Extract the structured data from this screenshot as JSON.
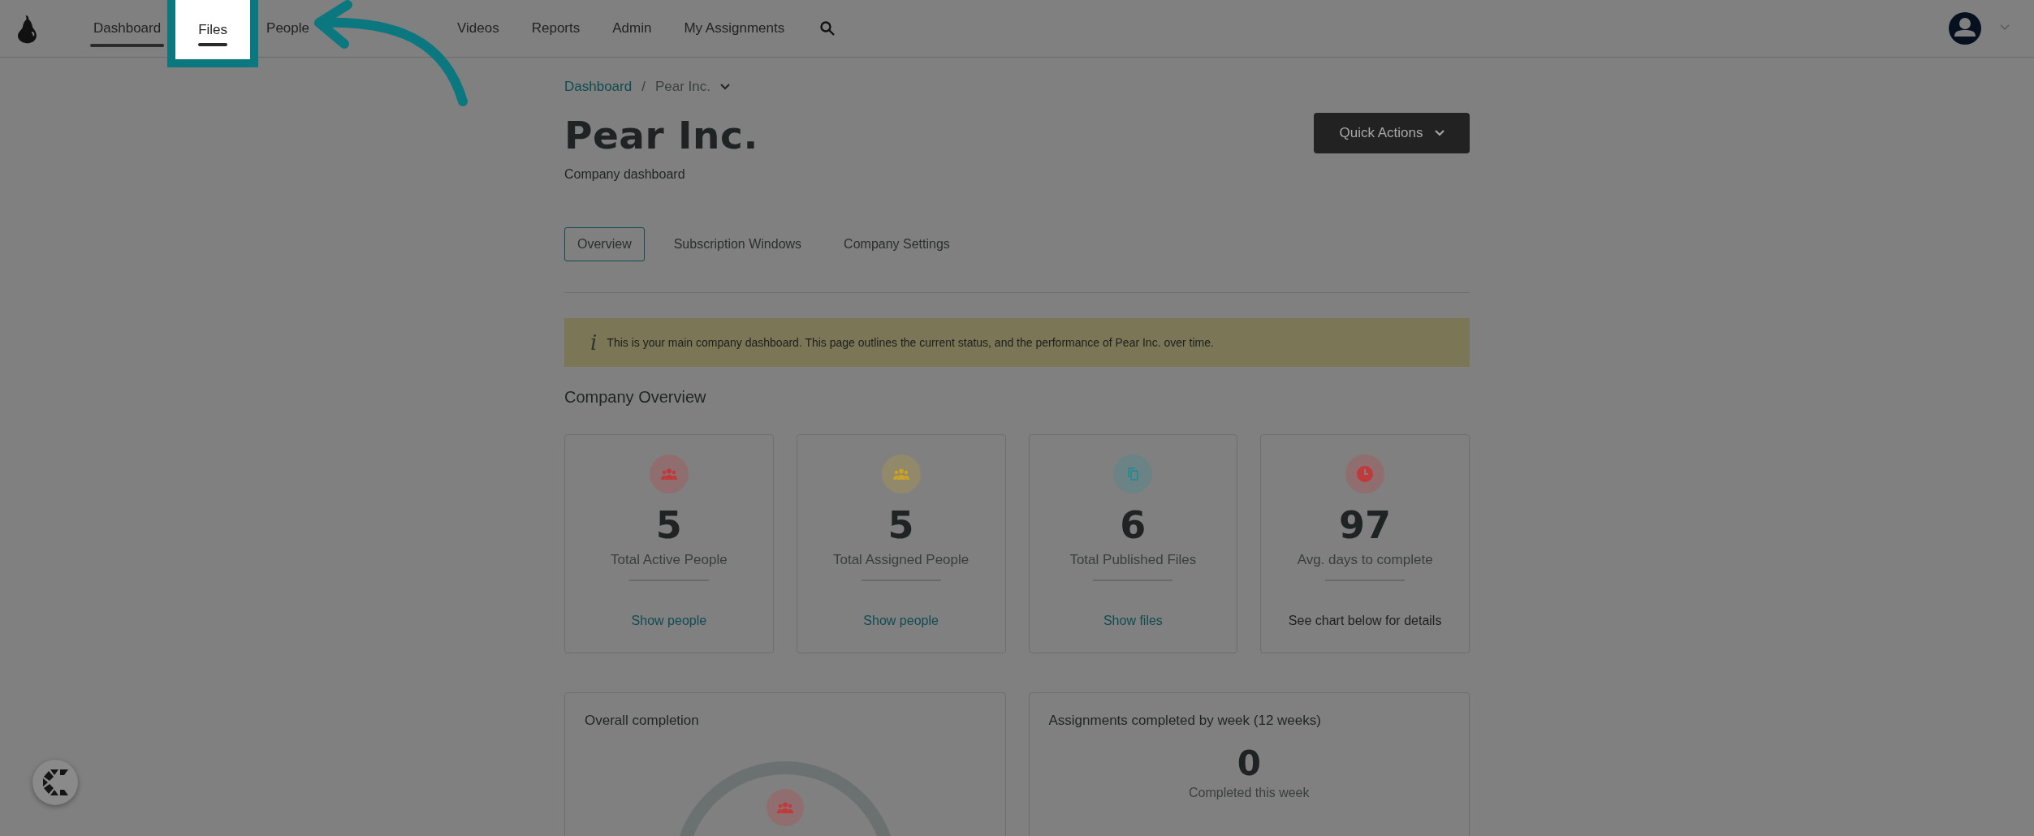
{
  "nav": {
    "items": [
      {
        "label": "Dashboard",
        "selected": true,
        "highlighted": false
      },
      {
        "label": "Files",
        "selected": false,
        "highlighted": true
      },
      {
        "label": "People",
        "selected": false,
        "highlighted": false
      },
      {
        "label": "Videos",
        "selected": false,
        "highlighted": false
      },
      {
        "label": "Reports",
        "selected": false,
        "highlighted": false
      },
      {
        "label": "Admin",
        "selected": false,
        "highlighted": false
      },
      {
        "label": "My Assignments",
        "selected": false,
        "highlighted": false
      }
    ]
  },
  "breadcrumb": {
    "link": "Dashboard",
    "separator": "/",
    "current": "Pear Inc."
  },
  "header": {
    "title": "Pear Inc.",
    "subtitle": "Company dashboard",
    "action": "Quick Actions"
  },
  "tabs": [
    {
      "label": "Overview",
      "selected": true
    },
    {
      "label": "Subscription Windows",
      "selected": false
    },
    {
      "label": "Company Settings",
      "selected": false
    }
  ],
  "notice": {
    "icon": "i",
    "text": "This is your main company dashboard. This page outlines the current status, and the performance of Pear Inc. over time."
  },
  "overview": {
    "title": "Company Overview",
    "cards": [
      {
        "kind": "people",
        "color": "#c0393b",
        "value": "5",
        "label": "Total Active People",
        "footer": "Show people",
        "footer_link": true
      },
      {
        "kind": "people",
        "color": "#c9a227",
        "value": "5",
        "label": "Total Assigned People",
        "footer": "Show people",
        "footer_link": true
      },
      {
        "kind": "files",
        "color": "#2a8a94",
        "value": "6",
        "label": "Total Published Files",
        "footer": "Show files",
        "footer_link": true
      },
      {
        "kind": "time",
        "color": "#c0393b",
        "value": "97",
        "label": "Avg. days to complete",
        "footer": "See chart below for details",
        "footer_link": false
      }
    ]
  },
  "panels": [
    {
      "title": "Overall completion",
      "kind": "ring"
    },
    {
      "title": "Assignments completed by week (12 weeks)",
      "kind": "stat",
      "value": "0",
      "caption": "Completed this week"
    }
  ]
}
